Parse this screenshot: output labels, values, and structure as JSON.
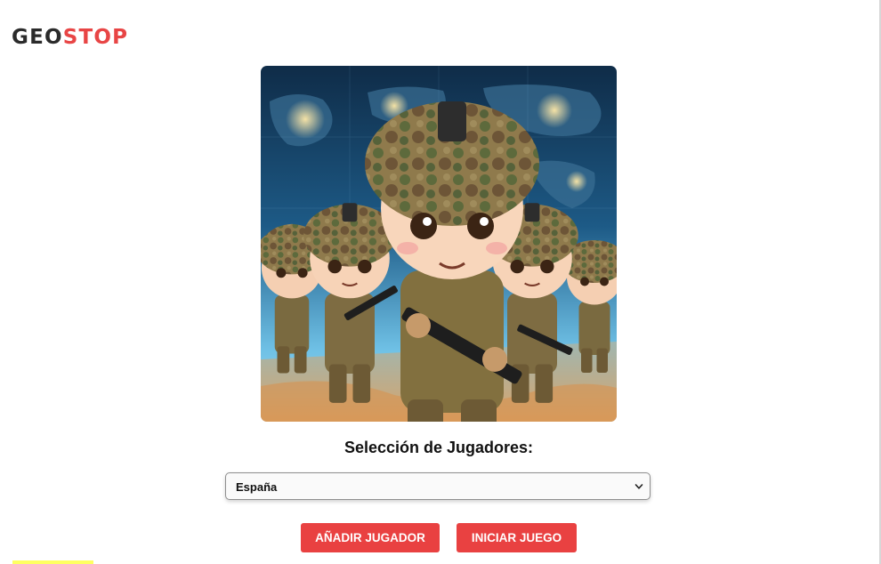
{
  "brand": {
    "part1": "GEO",
    "part2": "STOP",
    "colors": {
      "dark": "#2b2b2b",
      "accent": "#e84545"
    }
  },
  "hero": {
    "icon": "chibi-soldiers-world-map-illustration"
  },
  "players": {
    "title": "Selección de Jugadores:",
    "country_select": {
      "selected": "España",
      "icon": "chevron-down-icon"
    }
  },
  "actions": {
    "add_player": "AÑADIR JUGADOR",
    "start_game": "INICIAR JUEGO",
    "button_color": "#e94141"
  }
}
